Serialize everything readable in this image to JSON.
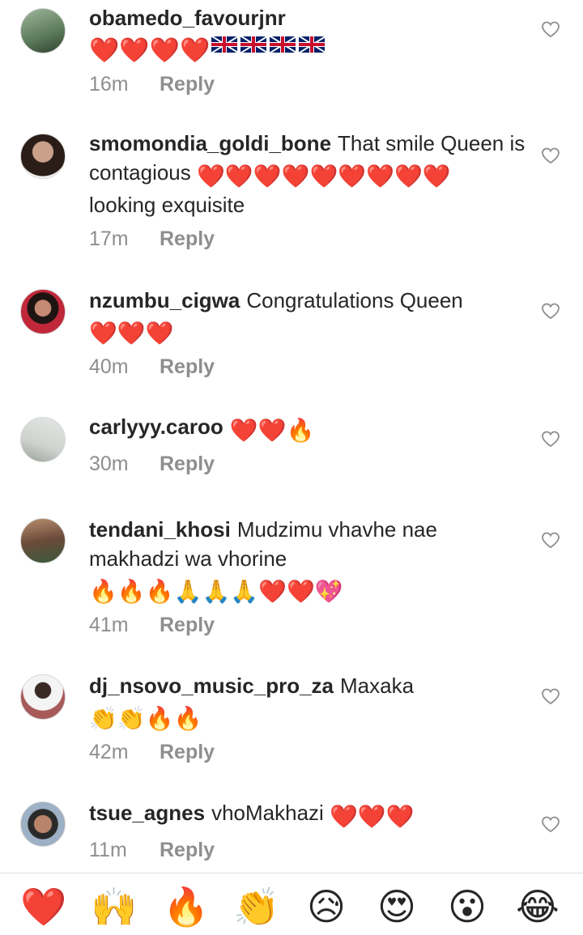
{
  "comments": [
    {
      "username": "obamedo_favourjnr",
      "text": "",
      "emojis": "❤️❤️❤️❤️",
      "flags": 4,
      "time": "16m",
      "reply": "Reply",
      "avatar_color": "#5a7a5a"
    },
    {
      "username": "smomondia_goldi_bone",
      "text": "That smile Queen is contagious",
      "emojis": "❤️❤️❤️❤️❤️❤️❤️❤️❤️",
      "text2": "looking exquisite",
      "time": "17m",
      "reply": "Reply",
      "avatar_color": "#3b2a24"
    },
    {
      "username": "nzumbu_cigwa",
      "text": "Congratulations Queen",
      "emojis": "❤️❤️❤️",
      "time": "40m",
      "reply": "Reply",
      "avatar_color": "#b23a48"
    },
    {
      "username": "carlyyy.caroo",
      "text": "",
      "emojis": "❤️❤️🔥",
      "time": "30m",
      "reply": "Reply",
      "avatar_color": "#cfd3cf"
    },
    {
      "username": "tendani_khosi",
      "text": "Mudzimu vhavhe nae makhadzi wa vhorine",
      "emojis": "🔥🔥🔥🙏🙏🙏❤️❤️💖",
      "time": "41m",
      "reply": "Reply",
      "avatar_color": "#6b4a3a"
    },
    {
      "username": "dj_nsovo_music_pro_za",
      "text": "Maxaka",
      "emojis": "👏👏🔥🔥",
      "time": "42m",
      "reply": "Reply",
      "avatar_color": "#7a6a6a"
    },
    {
      "username": "tsue_agnes",
      "text": "vhoMakhazi",
      "emojis": "❤️❤️❤️",
      "time": "11m",
      "reply": "Reply",
      "avatar_color": "#6d7f93"
    }
  ],
  "reactions": [
    "❤️",
    "🙌",
    "🔥",
    "👏",
    "😥",
    "😍",
    "😮",
    "😂"
  ],
  "colors": {
    "heart_red": "#ed4956",
    "meta_gray": "#8e8e8e",
    "text": "#262626"
  }
}
